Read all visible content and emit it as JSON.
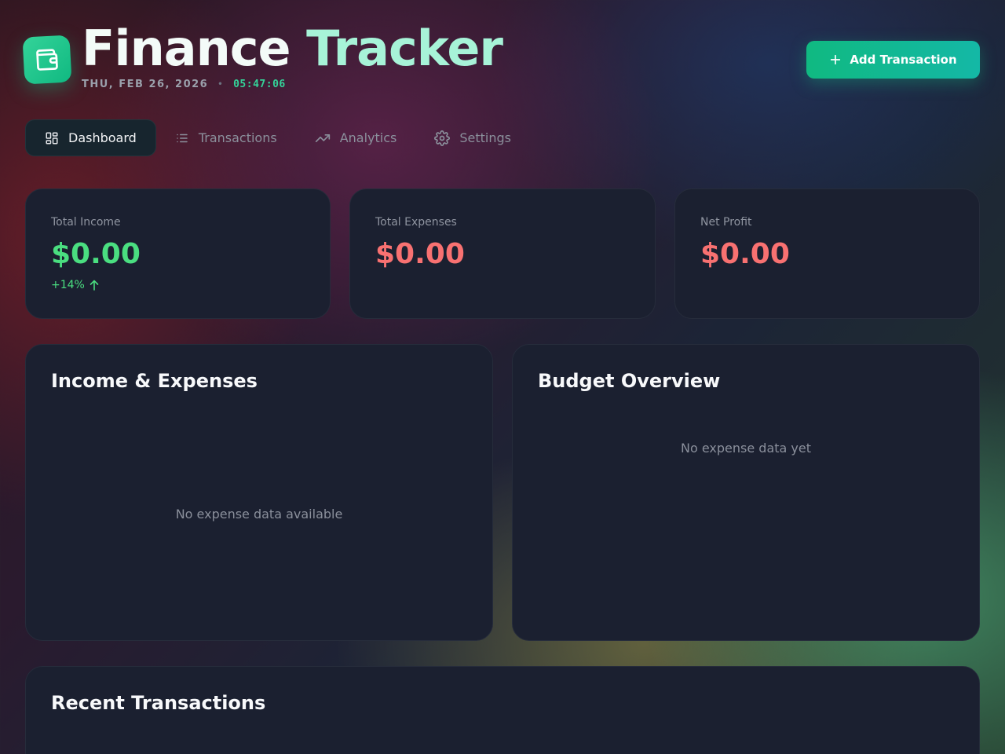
{
  "app": {
    "title_main": "Finance",
    "title_accent": "Tracker",
    "date": "THU, FEB 26, 2026",
    "separator": "•",
    "time": "05:47:06",
    "logo_icon": "wallet-icon"
  },
  "header": {
    "add_button_label": "Add Transaction",
    "add_button_icon": "plus-icon"
  },
  "tabs": [
    {
      "label": "Dashboard",
      "icon": "grid-icon",
      "active": true
    },
    {
      "label": "Transactions",
      "icon": "list-icon",
      "active": false
    },
    {
      "label": "Analytics",
      "icon": "trending-up-icon",
      "active": false
    },
    {
      "label": "Settings",
      "icon": "gear-icon",
      "active": false
    }
  ],
  "stats": [
    {
      "label": "Total Income",
      "value": "$0.00",
      "color": "#4ade80",
      "trend": "+14%",
      "trend_icon": "arrow-up-icon"
    },
    {
      "label": "Total Expenses",
      "value": "$0.00",
      "color": "#f87171"
    },
    {
      "label": "Net Profit",
      "value": "$0.00",
      "color": "#f87171"
    }
  ],
  "panels": {
    "income_expenses": {
      "title": "Income & Expenses",
      "empty_text": "No expense data available"
    },
    "budget": {
      "title": "Budget Overview",
      "empty_text": "No expense data yet"
    },
    "recent": {
      "title": "Recent Transactions"
    }
  },
  "colors": {
    "accent": "#10b981",
    "card_bg": "#1b2030",
    "income": "#4ade80",
    "expense": "#f87171"
  }
}
